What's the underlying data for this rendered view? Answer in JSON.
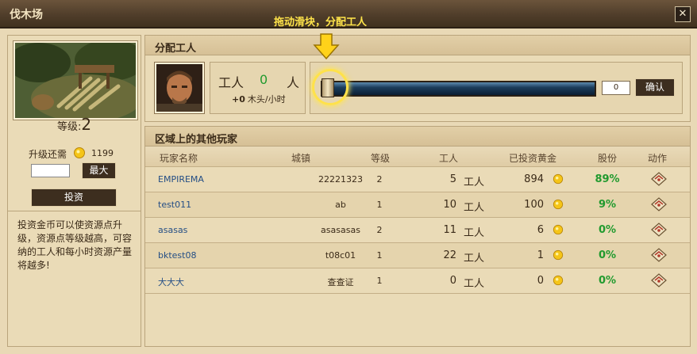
{
  "window": {
    "title": "伐木场",
    "close_glyph": "✕"
  },
  "hint": "拖动滑块，分配工人",
  "left": {
    "level_label": "等级:",
    "level_value": "2",
    "upgrade_label": "升级还需",
    "upgrade_cost": "1199",
    "invest_value": "",
    "max_label": "最大",
    "invest_label": "投资",
    "description": "投资金币可以使资源点升级，资源点等级越高，可容纳的工人和每小时资源产量将越多!"
  },
  "assign": {
    "section_title": "分配工人",
    "workers_label": "工人",
    "workers_count": "0",
    "workers_unit": "人",
    "rate_value": "+0",
    "rate_unit": "木头/小时",
    "slider_value": "0",
    "slider_fraction": 0,
    "confirm_label": "确认"
  },
  "players": {
    "section_title": "区域上的其他玩家",
    "columns": [
      "玩家名称",
      "城镇",
      "等级",
      "工人",
      "已投资黄金",
      "股份",
      "动作"
    ],
    "rows": [
      {
        "name": "EMPIREMA",
        "town": "22221323",
        "level": "2",
        "workers": "5",
        "workers_unit": "工人",
        "gold": "894",
        "share": "89%"
      },
      {
        "name": "test011",
        "town": "ab",
        "level": "1",
        "workers": "10",
        "workers_unit": "工人",
        "gold": "100",
        "share": "9%"
      },
      {
        "name": "asasas",
        "town": "asasasas",
        "level": "2",
        "workers": "11",
        "workers_unit": "工人",
        "gold": "6",
        "share": "0%"
      },
      {
        "name": "bktest08",
        "town": "t08c01",
        "level": "1",
        "workers": "22",
        "workers_unit": "工人",
        "gold": "1",
        "share": "0%"
      },
      {
        "name": "大大大",
        "town": "查查证",
        "level": "1",
        "workers": "0",
        "workers_unit": "工人",
        "gold": "0",
        "share": "0%"
      }
    ]
  },
  "colors": {
    "share_green": "#219a2e",
    "name_blue": "#244e85",
    "hint_yellow": "#ffe44a",
    "gold_coin": "#f5c518"
  },
  "icons": {
    "coin": "gold-coin-icon",
    "action": "scroll-action-icon",
    "arrow": "down-arrow-icon"
  }
}
